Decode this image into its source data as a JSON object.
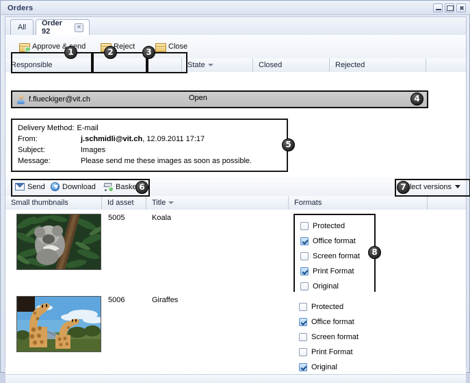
{
  "window": {
    "title": "Orders",
    "controls": [
      {
        "name": "minimize",
        "glyph": "minimize-icon"
      },
      {
        "name": "maximize",
        "glyph": "maximize-icon"
      },
      {
        "name": "close",
        "glyph": "close-icon"
      }
    ]
  },
  "tabs": [
    {
      "label": "All",
      "active": false,
      "closable": false
    },
    {
      "label": "Order 92",
      "active": true,
      "closable": true,
      "close_glyph": "✕"
    }
  ],
  "toolbar_top": {
    "buttons": [
      {
        "label": "Approve & send",
        "icon": "box-approve-icon",
        "badge": "1"
      },
      {
        "label": "Reject",
        "icon": "box-reject-icon",
        "badge": "2"
      },
      {
        "label": "Close",
        "icon": "box-icon",
        "badge": "3"
      }
    ]
  },
  "order_grid": {
    "columns": [
      "Responsible",
      "State",
      "Closed",
      "Rejected"
    ],
    "sorted_column": "State",
    "rows": [
      {
        "responsible": "f.flueckiger@vit.ch",
        "responsible_icon": "user-icon",
        "state": "Open",
        "closed": "",
        "rejected": "",
        "badge": "4",
        "selected": true
      }
    ]
  },
  "message_box": {
    "badge": "5",
    "delivery_label": "Delivery Method:",
    "delivery_value": "E-mail",
    "from_label": "From:",
    "from_address": "j.schmidli@vit.ch",
    "from_date": ", 12.09.2011 17:17",
    "subject_label": "Subject:",
    "subject_value": "Images",
    "message_label": "Message:",
    "message_value": "Please send me these images as soon as possible."
  },
  "toolbar_bottom": {
    "badge": "6",
    "buttons": [
      {
        "label": "Send",
        "icon": "mail-icon"
      },
      {
        "label": "Download",
        "icon": "download-icon"
      },
      {
        "label": "Basket",
        "icon": "cart-add-icon"
      }
    ],
    "select_versions": {
      "label": "Select versions",
      "badge": "7",
      "caret": "chevron-down-icon"
    }
  },
  "asset_grid": {
    "columns": [
      "Small thumbnails",
      "Id asset",
      "Title",
      "Formats"
    ],
    "sorted_column": "Title",
    "formats_badge": "8",
    "rows": [
      {
        "thumbnail": "koala-thumbnail",
        "id_asset": "5005",
        "title": "Koala",
        "formats_boxed": true,
        "formats": [
          {
            "label": "Protected",
            "checked": false
          },
          {
            "label": "Office format",
            "checked": true
          },
          {
            "label": "Screen format",
            "checked": false
          },
          {
            "label": "Print Format",
            "checked": true
          },
          {
            "label": "Original",
            "checked": false
          }
        ]
      },
      {
        "thumbnail": "giraffes-thumbnail",
        "id_asset": "5006",
        "title": "Giraffes",
        "formats_boxed": false,
        "formats": [
          {
            "label": "Protected",
            "checked": false
          },
          {
            "label": "Office format",
            "checked": true
          },
          {
            "label": "Screen format",
            "checked": false
          },
          {
            "label": "Print Format",
            "checked": false
          },
          {
            "label": "Original",
            "checked": true
          }
        ]
      }
    ]
  },
  "colors": {
    "titlebar_text": "#2b3a5c",
    "window_bg": "#c8d2e4",
    "panel_bg": "#ffffff",
    "header_grad_top": "#f8fafc",
    "header_grad_bottom": "#e7ecf4",
    "selected_row": "#c7c7c7",
    "callout_outline": "#111111",
    "checkbox_checked": "#a9cdf2",
    "accent_blue": "#1f72c4"
  }
}
